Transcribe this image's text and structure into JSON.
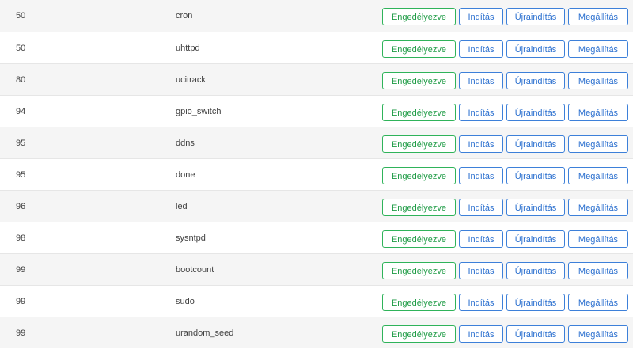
{
  "buttons": {
    "enabled_label": "Engedélyezve",
    "start_label": "Indítás",
    "restart_label": "Újraindítás",
    "stop_label": "Megállítás"
  },
  "colors": {
    "enabled": "#2fb35a",
    "action": "#3d80d9",
    "row_alt": "#f5f5f5"
  },
  "services": [
    {
      "priority": "50",
      "name": "cron"
    },
    {
      "priority": "50",
      "name": "uhttpd"
    },
    {
      "priority": "80",
      "name": "ucitrack"
    },
    {
      "priority": "94",
      "name": "gpio_switch"
    },
    {
      "priority": "95",
      "name": "ddns"
    },
    {
      "priority": "95",
      "name": "done"
    },
    {
      "priority": "96",
      "name": "led"
    },
    {
      "priority": "98",
      "name": "sysntpd"
    },
    {
      "priority": "99",
      "name": "bootcount"
    },
    {
      "priority": "99",
      "name": "sudo"
    },
    {
      "priority": "99",
      "name": "urandom_seed"
    }
  ]
}
